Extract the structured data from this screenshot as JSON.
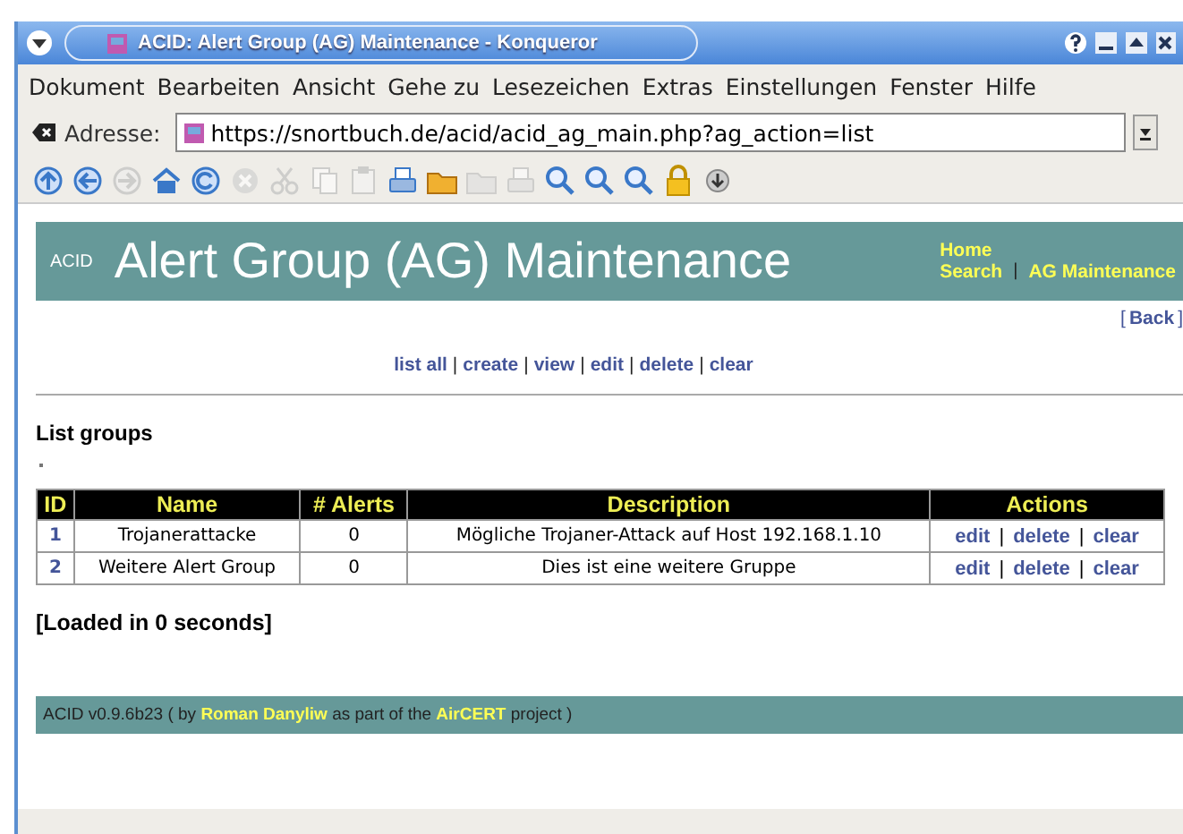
{
  "window": {
    "title": "ACID: Alert Group (AG) Maintenance - Konqueror"
  },
  "menu": [
    "Dokument",
    "Bearbeiten",
    "Ansicht",
    "Gehe zu",
    "Lesezeichen",
    "Extras",
    "Einstellungen",
    "Fenster",
    "Hilfe"
  ],
  "address_bar": {
    "label": "Adresse:",
    "url": "https://snortbuch.de/acid/acid_ag_main.php?ag_action=list"
  },
  "toolbar": [
    {
      "kind": "up",
      "disabled": false
    },
    {
      "kind": "back",
      "disabled": false
    },
    {
      "kind": "forward",
      "disabled": true
    },
    {
      "kind": "home",
      "disabled": false
    },
    {
      "kind": "reload",
      "disabled": false
    },
    {
      "kind": "stop",
      "disabled": true
    },
    {
      "kind": "cut",
      "disabled": true
    },
    {
      "kind": "copy",
      "disabled": true
    },
    {
      "kind": "paste",
      "disabled": true
    },
    {
      "kind": "print",
      "disabled": false
    },
    {
      "kind": "folder",
      "disabled": false
    },
    {
      "kind": "folder",
      "disabled": true
    },
    {
      "kind": "print",
      "disabled": true
    },
    {
      "kind": "zoom",
      "disabled": false
    },
    {
      "kind": "zoom",
      "disabled": false
    },
    {
      "kind": "zoom",
      "disabled": false
    },
    {
      "kind": "lock",
      "disabled": false
    },
    {
      "kind": "download",
      "disabled": false
    }
  ],
  "banner": {
    "logo": "ACID",
    "title": "Alert Group (AG) Maintenance",
    "nav": [
      "Home",
      "Search",
      "|",
      "AG Maintenance"
    ]
  },
  "back_link": {
    "open": "[",
    "label": "Back",
    "close": "]"
  },
  "actions": [
    {
      "kind": "link",
      "text": "list all"
    },
    {
      "kind": "separator",
      "text": "|"
    },
    {
      "kind": "link",
      "text": "create"
    },
    {
      "kind": "separator",
      "text": "|"
    },
    {
      "kind": "link",
      "text": "view"
    },
    {
      "kind": "separator",
      "text": "|"
    },
    {
      "kind": "link",
      "text": "edit"
    },
    {
      "kind": "separator",
      "text": "|"
    },
    {
      "kind": "link",
      "text": "delete"
    },
    {
      "kind": "separator",
      "text": "|"
    },
    {
      "kind": "link",
      "text": "clear"
    }
  ],
  "heading": "List groups",
  "table": {
    "columns": [
      "ID",
      "Name",
      "# Alerts",
      "Description",
      "Actions"
    ],
    "rows": [
      {
        "id": "1",
        "name": "Trojanerattacke",
        "alerts": "0",
        "description": "Mögliche Trojaner-Attack auf Host 192.168.1.10",
        "actions": [
          {
            "kind": "link",
            "text": "edit"
          },
          {
            "kind": "separator",
            "text": "|"
          },
          {
            "kind": "link",
            "text": "delete"
          },
          {
            "kind": "separator",
            "text": "|"
          },
          {
            "kind": "link",
            "text": "clear"
          }
        ]
      },
      {
        "id": "2",
        "name": "Weitere Alert Group",
        "alerts": "0",
        "description": "Dies ist eine weitere Gruppe",
        "actions": [
          {
            "kind": "link",
            "text": "edit"
          },
          {
            "kind": "separator",
            "text": "|"
          },
          {
            "kind": "link",
            "text": "delete"
          },
          {
            "kind": "separator",
            "text": "|"
          },
          {
            "kind": "link",
            "text": "clear"
          }
        ]
      }
    ]
  },
  "load_time": "[Loaded in 0 seconds]",
  "footer": [
    {
      "kind": "text",
      "text": "ACID v0.9.6b23 ( by "
    },
    {
      "kind": "link",
      "text": "Roman Danyliw"
    },
    {
      "kind": "text",
      "text": " as part of the "
    },
    {
      "kind": "link",
      "text": "AirCERT"
    },
    {
      "kind": "text",
      "text": " project )"
    }
  ]
}
